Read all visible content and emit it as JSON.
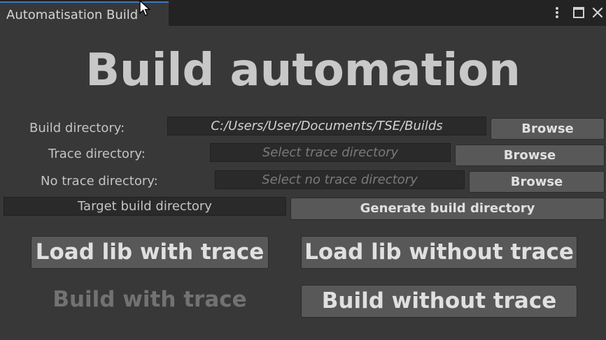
{
  "window": {
    "tab_title": "Automatisation Build",
    "icons": [
      "more-options-icon",
      "maximize-icon",
      "close-icon"
    ]
  },
  "main": {
    "heading": "Build automation",
    "build_directory": {
      "label": "Build directory:",
      "value": "C:/Users/User/Documents/TSE/Builds",
      "browse_label": "Browse"
    },
    "trace_directory": {
      "label": "Trace directory:",
      "placeholder": "Select trace directory",
      "browse_label": "Browse"
    },
    "no_trace_directory": {
      "label": "No trace directory:",
      "placeholder": "Select no trace directory",
      "browse_label": "Browse"
    },
    "target_build_directory": {
      "value": "Target build directory",
      "generate_label": "Generate build directory"
    },
    "actions": {
      "load_lib_with_trace": "Load lib with trace",
      "load_lib_without_trace": "Load lib without trace",
      "build_with_trace": "Build with trace",
      "build_without_trace": "Build without trace"
    }
  },
  "colors": {
    "background": "#383838",
    "titlebar": "#232323",
    "tab_accent": "#3a79bb",
    "button": "#585858",
    "field": "#2a2a2a",
    "disabled_text": "#727272"
  }
}
